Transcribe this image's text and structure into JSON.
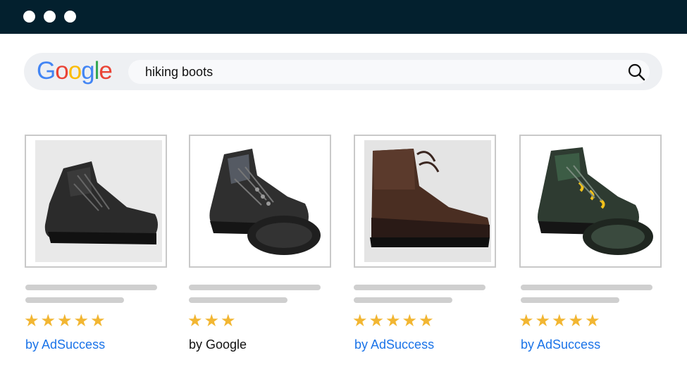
{
  "window": {
    "controls": [
      "window-dot",
      "window-dot",
      "window-dot"
    ]
  },
  "search": {
    "logo": {
      "letters": [
        "G",
        "o",
        "o",
        "g",
        "l",
        "e"
      ],
      "colors": [
        "#4285F4",
        "#EA4335",
        "#FBBC05",
        "#4285F4",
        "#34A853",
        "#EA4335"
      ]
    },
    "query": "hiking boots",
    "icon": "search-icon"
  },
  "colors": {
    "star": "#f2b632",
    "ad_link": "#1a73e8",
    "organic_link": "#111111",
    "titlebar": "#03202e"
  },
  "results": [
    {
      "image": "black-hiking-boot",
      "stars": 5,
      "rating_text": "★★★★★",
      "brand": "by AdSuccess"
    },
    {
      "image": "black-hiking-boots-pair",
      "stars": 3,
      "rating_text": "★★★",
      "brand": "by Google"
    },
    {
      "image": "brown-leather-boot",
      "stars": 5,
      "rating_text": "★★★★★",
      "brand": "by AdSuccess"
    },
    {
      "image": "green-hiking-boots-pair",
      "stars": 5,
      "rating_text": "★★★★★",
      "brand": "by AdSuccess"
    }
  ]
}
